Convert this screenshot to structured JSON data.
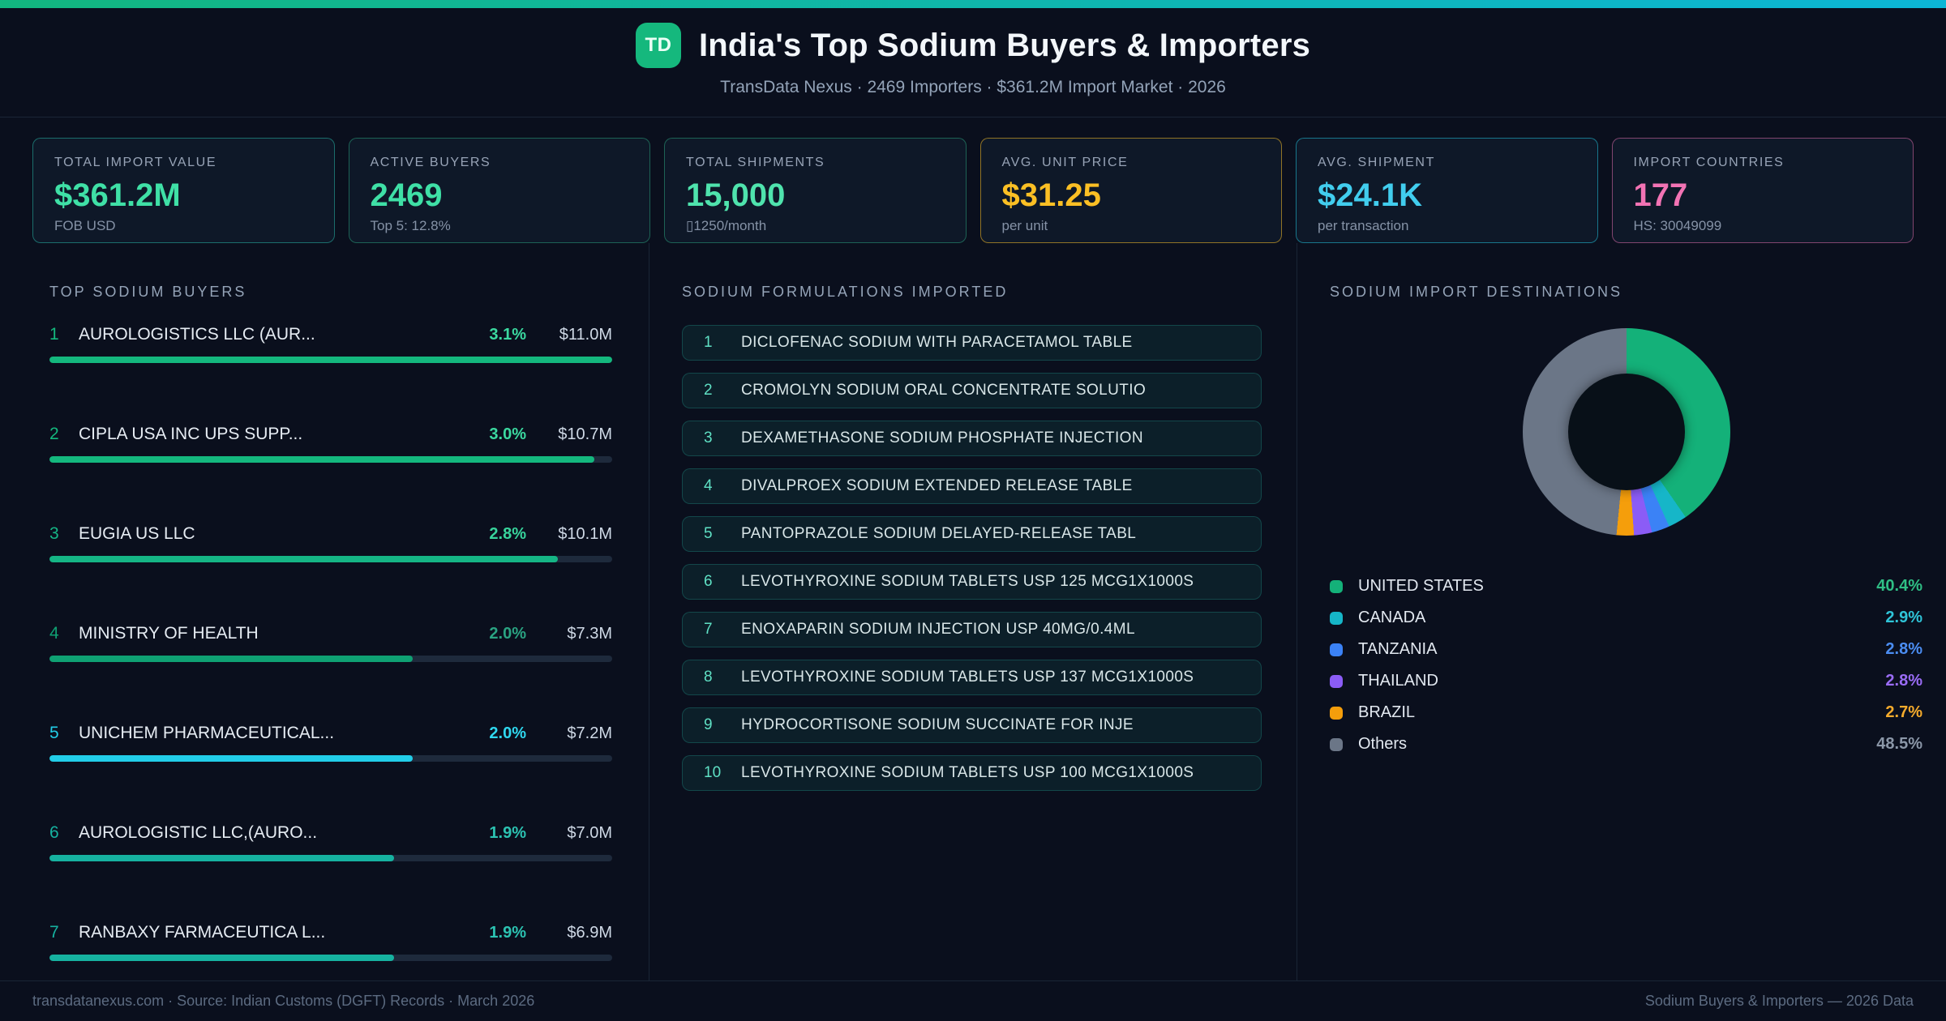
{
  "header": {
    "badge": "TD",
    "title": "India's Top Sodium Buyers & Importers",
    "subtitle": "TransData Nexus · 2469 Importers · $361.2M Import Market · 2026"
  },
  "stats": [
    {
      "label": "TOTAL IMPORT VALUE",
      "value": "$361.2M",
      "sub": "FOB USD",
      "value_color": "#3fe0a6",
      "border_color": "#2dd4bf73"
    },
    {
      "label": "ACTIVE BUYERS",
      "value": "2469",
      "sub": "Top 5: 12.8%",
      "value_color": "#3fe0a6",
      "border_color": "#34d39966"
    },
    {
      "label": "TOTAL SHIPMENTS",
      "value": "15,000",
      "sub": "▯1250/month",
      "value_color": "#4fe3ad",
      "border_color": "#34d39966"
    },
    {
      "label": "AVG. UNIT PRICE",
      "value": "$31.25",
      "sub": "per unit",
      "value_color": "#fbbf24",
      "border_color": "#fbbf248c"
    },
    {
      "label": "AVG. SHIPMENT",
      "value": "$24.1K",
      "sub": "per transaction",
      "value_color": "#41cdee",
      "border_color": "#22d3ee80"
    },
    {
      "label": "IMPORT COUNTRIES",
      "value": "177",
      "sub": "HS: 30049099",
      "value_color": "#f273b4",
      "border_color": "#f472b680"
    }
  ],
  "chart_data": [
    {
      "type": "bar",
      "orientation": "horizontal",
      "title": "TOP SODIUM BUYERS",
      "categories": [
        "AUROLOGISTICS LLC (AUR...",
        "CIPLA USA INC UPS SUPP...",
        "EUGIA US LLC",
        "MINISTRY OF HEALTH",
        "UNICHEM PHARMACEUTICAL...",
        "AUROLOGISTIC LLC,(AURO...",
        "RANBAXY FARMACEUTICA L..."
      ],
      "values": [
        3.1,
        3.0,
        2.8,
        2.0,
        2.0,
        1.9,
        1.9
      ],
      "value_labels": [
        "3.1%",
        "3.0%",
        "2.8%",
        "2.0%",
        "2.0%",
        "1.9%",
        "1.9%"
      ],
      "amount_labels": [
        "$11.0M",
        "$10.7M",
        "$10.1M",
        "$7.3M",
        "$7.2M",
        "$7.0M",
        "$6.9M"
      ],
      "bar_colors": [
        "#14b87e",
        "#14b87e",
        "#15b585",
        "#0fa173",
        "#22cde8",
        "#16b2a0",
        "#16b2a0"
      ],
      "text_colors": [
        "#3bd9a0",
        "#3bd9a0",
        "#38d49c",
        "#2aa382",
        "#2fd8ef",
        "#2cc3b2",
        "#2cc3b2"
      ],
      "xlim": [
        0,
        3.1
      ],
      "grid": false
    },
    {
      "type": "pie",
      "donut": true,
      "hole_ratio": 0.56,
      "title": "SODIUM IMPORT DESTINATIONS",
      "labels": [
        "UNITED STATES",
        "CANADA",
        "TANZANIA",
        "THAILAND",
        "BRAZIL",
        "Others"
      ],
      "values": [
        40.4,
        2.9,
        2.8,
        2.8,
        2.7,
        48.5
      ],
      "value_labels": [
        "40.4%",
        "2.9%",
        "2.8%",
        "2.8%",
        "2.7%",
        "48.5%"
      ],
      "colors": [
        "#14b179",
        "#16b6c8",
        "#3b82f6",
        "#8b5cf6",
        "#f59e0b",
        "#6b7687"
      ],
      "pct_text_colors": [
        "#2fbf85",
        "#2fc4d8",
        "#4b8df2",
        "#9a6cf5",
        "#f5ab2c",
        "#8b97a8"
      ],
      "legend_position": "bottom"
    }
  ],
  "formulations": {
    "title": "SODIUM FORMULATIONS IMPORTED",
    "items": [
      "DICLOFENAC SODIUM WITH PARACETAMOL TABLE",
      "CROMOLYN SODIUM ORAL CONCENTRATE SOLUTIO",
      "DEXAMETHASONE SODIUM PHOSPHATE INJECTION",
      "DIVALPROEX SODIUM EXTENDED RELEASE TABLE",
      "PANTOPRAZOLE SODIUM DELAYED-RELEASE TABL",
      "LEVOTHYROXINE SODIUM TABLETS USP 125 MCG1X1000S",
      "ENOXAPARIN SODIUM INJECTION USP 40MG/0.4ML",
      "LEVOTHYROXINE SODIUM TABLETS USP 137 MCG1X1000S",
      "HYDROCORTISONE SODIUM SUCCINATE FOR INJE",
      "LEVOTHYROXINE SODIUM TABLETS USP 100 MCG1X1000S"
    ]
  },
  "footer": {
    "left": "transdatanexus.com · Source: Indian Customs (DGFT) Records · March 2026",
    "right": "Sodium Buyers & Importers — 2026 Data"
  }
}
